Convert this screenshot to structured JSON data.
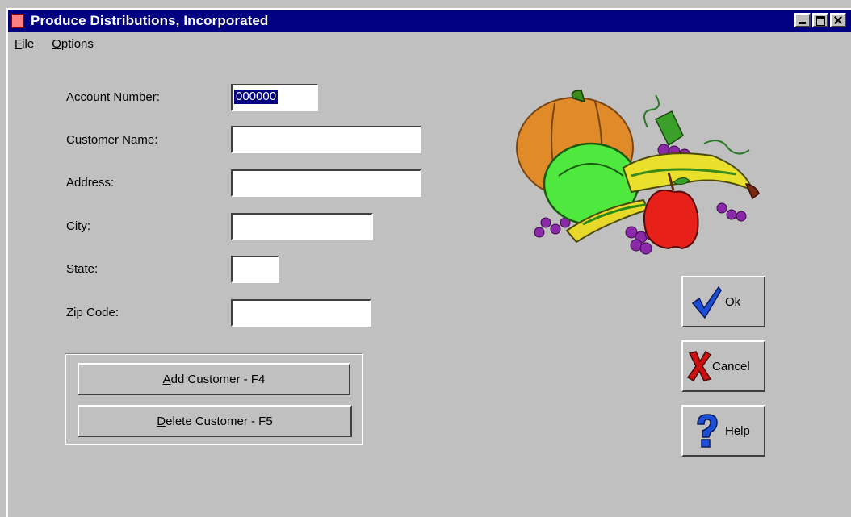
{
  "window": {
    "title": "Produce Distributions, Incorporated"
  },
  "menu": {
    "file": "File",
    "options": "Options"
  },
  "form": {
    "account_label": "Account Number:",
    "account_value": "000000",
    "name_label": "Customer Name:",
    "name_value": "",
    "address_label": "Address:",
    "address_value": "",
    "city_label": "City:",
    "city_value": "",
    "state_label": "State:",
    "state_value": "",
    "zip_label": "Zip Code:",
    "zip_value": ""
  },
  "actions": {
    "add_prefix": "A",
    "add_rest": "dd Customer - F4",
    "delete_prefix": "D",
    "delete_rest": "elete Customer - F5"
  },
  "side_buttons": {
    "ok": "Ok",
    "cancel": "Cancel",
    "help": "Help"
  },
  "icons": [
    "app-icon",
    "minimize-icon",
    "maximize-icon",
    "close-icon",
    "checkmark-icon",
    "x-mark-icon",
    "question-mark-icon",
    "produce-clipart"
  ],
  "colors": {
    "titlebar": "#000080",
    "face": "#c0c0c0",
    "ok_check": "#1a4fd6",
    "cancel_x": "#d01010",
    "help_q": "#1a4fd6"
  }
}
